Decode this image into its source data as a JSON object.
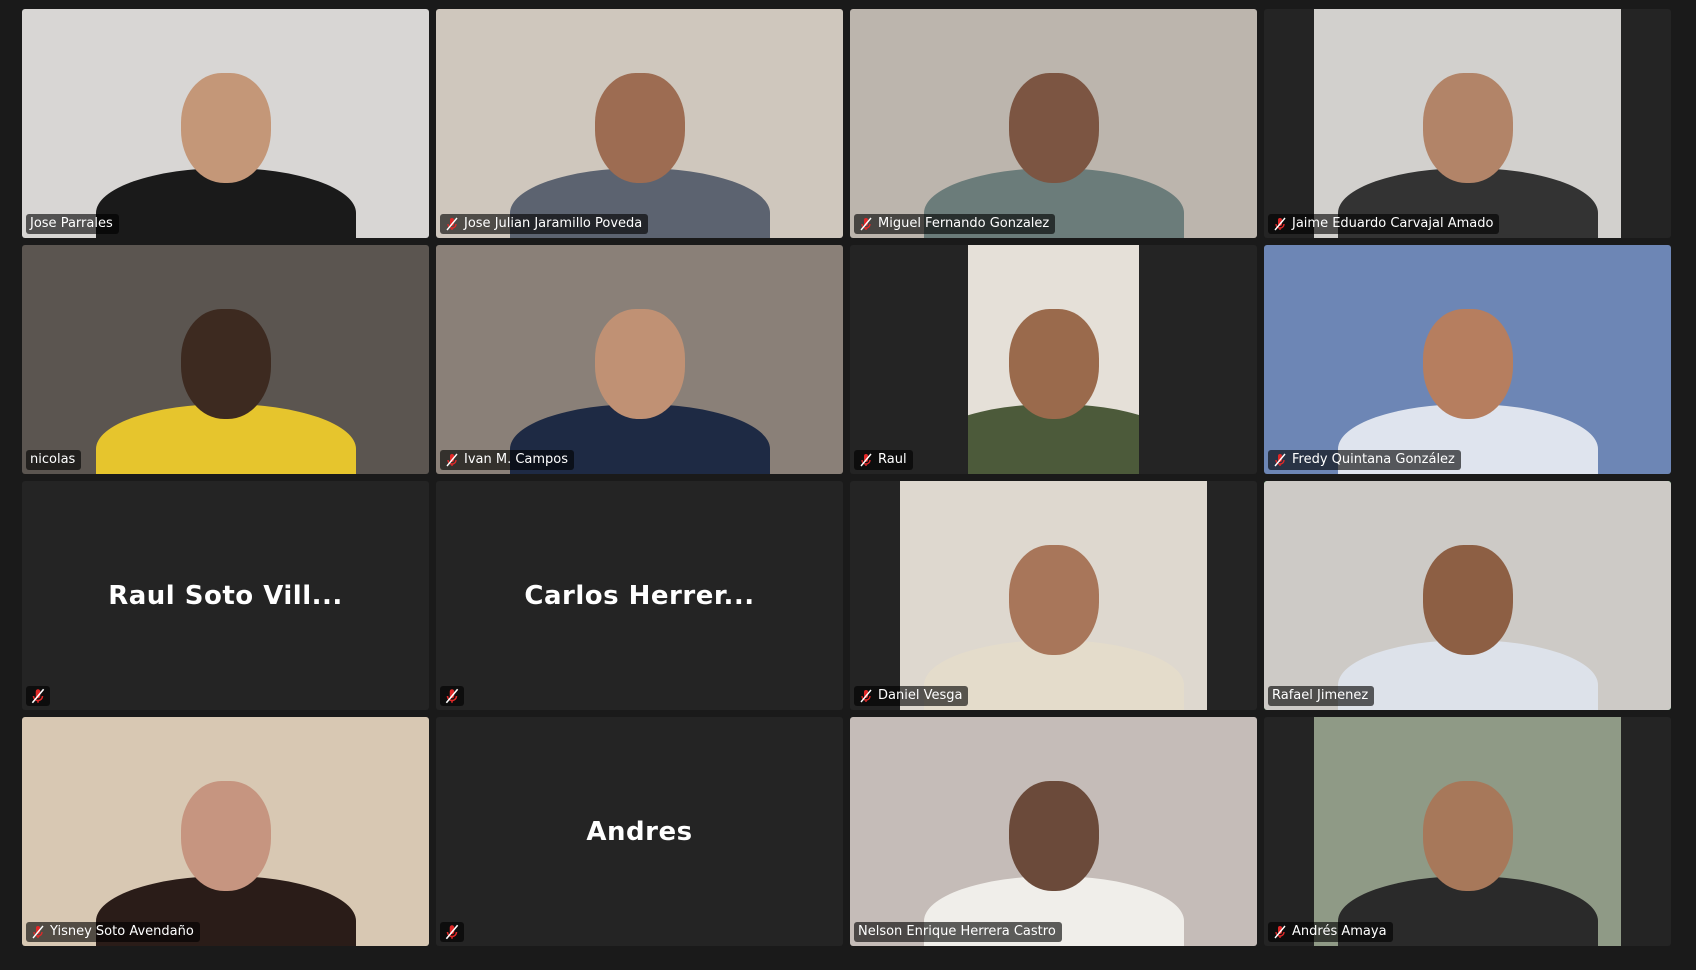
{
  "participants": [
    {
      "name": "Jose Parrales",
      "muted": false,
      "video": true,
      "bg": "#d8d6d4",
      "skin": "#c49778",
      "shirt": "#1a1a1a"
    },
    {
      "name": "Jose Julian Jaramillo Poveda",
      "muted": true,
      "video": true,
      "bg": "#cfc7bd",
      "skin": "#9d6c52",
      "shirt": "#5c6370"
    },
    {
      "name": "Miguel Fernando Gonzalez",
      "muted": true,
      "video": true,
      "bg": "#bcb5ad",
      "skin": "#7c5542",
      "shirt": "#6b7c7a"
    },
    {
      "name": "Jaime Eduardo Carvajal Amado",
      "muted": true,
      "video": true,
      "bg": "#d2d0cd",
      "skin": "#b28468",
      "shirt": "#333333"
    },
    {
      "name": "nicolas",
      "muted": false,
      "video": true,
      "bg": "#5b5550",
      "skin": "#3d2a20",
      "shirt": "#e6c52d"
    },
    {
      "name": "Ivan M. Campos",
      "muted": true,
      "video": true,
      "bg": "#8a8078",
      "skin": "#c09174",
      "shirt": "#1e2a44"
    },
    {
      "name": "Raul",
      "muted": true,
      "video": true,
      "bg": "#e5e0d8",
      "skin": "#9a6a4c",
      "shirt": "#4c5a3a"
    },
    {
      "name": "Fredy Quintana González",
      "muted": true,
      "video": true,
      "bg": "#6d86b5",
      "skin": "#b67e5f",
      "shirt": "#dfe4ee"
    },
    {
      "name": "Raul Soto Vill...",
      "muted": true,
      "video": false
    },
    {
      "name": "Carlos Herrer...",
      "muted": true,
      "video": false
    },
    {
      "name": "Daniel Vesga",
      "muted": true,
      "video": true,
      "bg": "#ded8cf",
      "skin": "#a8765a",
      "shirt": "#e4dccb"
    },
    {
      "name": "Rafael Jimenez",
      "muted": false,
      "video": true,
      "active": true,
      "bg": "#cdcac6",
      "skin": "#8d5f44",
      "shirt": "#dde2ea"
    },
    {
      "name": "Yisney Soto Avendaño",
      "muted": true,
      "video": true,
      "bg": "#d8c8b3",
      "skin": "#c69580",
      "shirt": "#2a1c18"
    },
    {
      "name": "Andres",
      "muted": true,
      "video": false
    },
    {
      "name": "Nelson Enrique Herrera Castro",
      "muted": false,
      "video": true,
      "bg": "#c5bcb8",
      "skin": "#6b4a3a",
      "shirt": "#f0eeea"
    },
    {
      "name": "Andrés Amaya",
      "muted": true,
      "video": true,
      "bg": "#8f9a86",
      "skin": "#a7785a",
      "shirt": "#2a2a2a"
    }
  ],
  "colors": {
    "active_speaker_border": "#23d959",
    "tile_background": "#242424",
    "window_background": "#1a1a1a",
    "muted_icon": "#e02828"
  }
}
